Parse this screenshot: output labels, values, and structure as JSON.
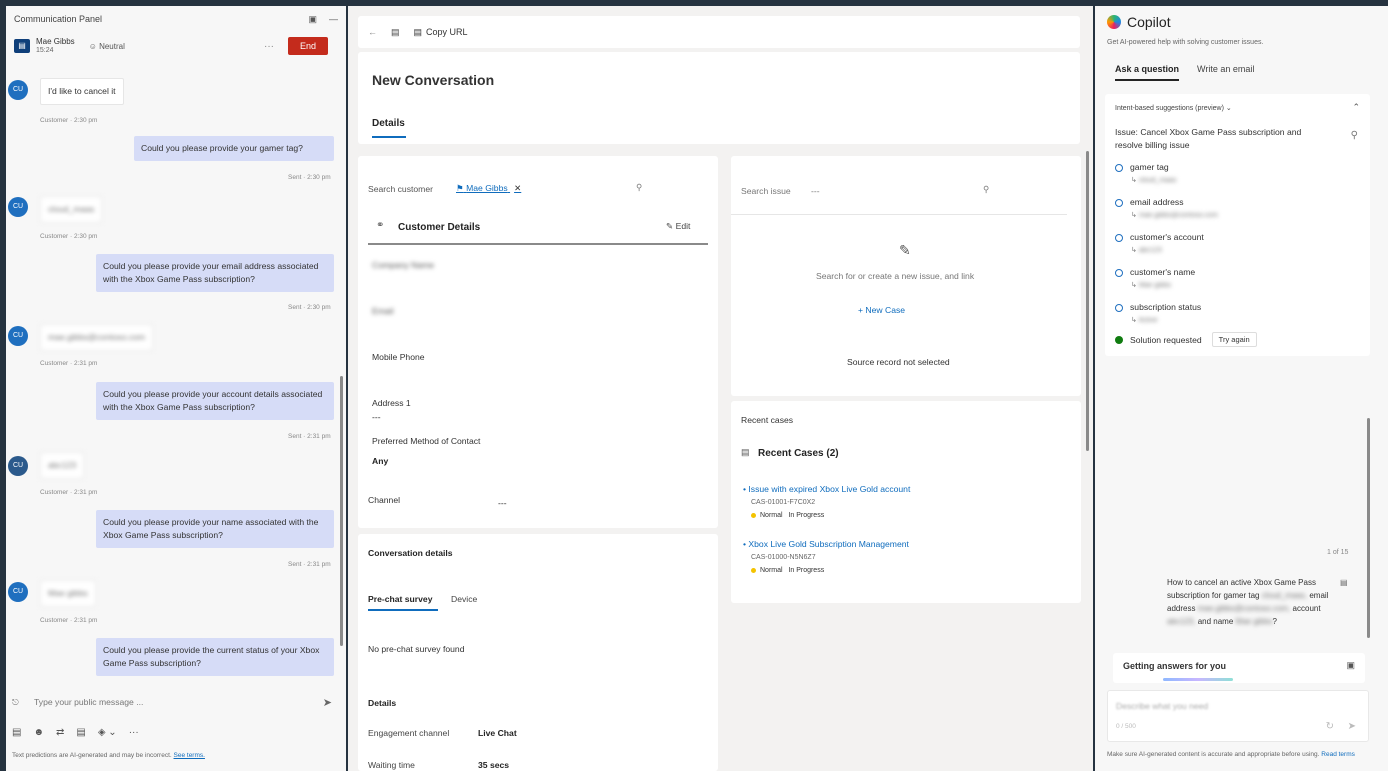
{
  "comm": {
    "title": "Communication Panel",
    "customer_name": "Mae Gibbs",
    "customer_time": "15:24",
    "sentiment": "Neutral",
    "end_label": "End",
    "messages": [
      {
        "text": "I'd like to cancel it",
        "meta": "Customer · 2:30 pm"
      },
      {
        "text": "Could you please provide your gamer tag?",
        "meta": "Sent · 2:30 pm"
      },
      {
        "text": "cloud_maas",
        "meta": "Customer · 2:30 pm"
      },
      {
        "text": "Could you please provide your email address associated with the Xbox Game Pass subscription?",
        "meta": "Sent · 2:30 pm"
      },
      {
        "text": "mae.gibbs@contoso.com",
        "meta": "Customer · 2:31 pm"
      },
      {
        "text": "Could you please provide your account details associated with the Xbox Game Pass subscription?",
        "meta": "Sent · 2:31 pm"
      },
      {
        "text": "abc123",
        "meta": "Customer · 2:31 pm"
      },
      {
        "text": "Could you please provide your name associated with the Xbox Game Pass subscription?",
        "meta": "Sent · 2:31 pm"
      },
      {
        "text": "Mae gibbs",
        "meta": "Customer · 2:31 pm"
      },
      {
        "text": "Could you please provide the current status of your Xbox Game Pass subscription?",
        "meta": ""
      }
    ],
    "compose_placeholder": "Type your public message ...",
    "disclaimer": "Text predictions are AI-generated and may be incorrect.",
    "see_terms": "See terms."
  },
  "main": {
    "copy_url": "Copy URL",
    "title": "New Conversation",
    "tab_details": "Details",
    "search_customer_label": "Search customer",
    "customer_link": "Mae Gibbs",
    "customer_details_title": "Customer Details",
    "edit_label": "Edit",
    "company_name": "Company Name",
    "email": "Email",
    "mobile_phone": "Mobile Phone",
    "address1": "Address 1",
    "address1_value": "---",
    "preferred_contact": "Preferred Method of Contact",
    "preferred_contact_value": "Any",
    "channel": "Channel",
    "channel_value": "---",
    "search_issue_label": "Search issue",
    "search_issue_value": "---",
    "issue_hint": "Search for or create a new issue, and link",
    "new_case": "+ New Case",
    "source_record": "Source record not selected",
    "recent_cases_label": "Recent cases",
    "recent_cases_title": "Recent Cases (2)",
    "cases": [
      {
        "title": "Issue with expired Xbox Live Gold account",
        "id": "CAS-01001-F7C0X2",
        "priority": "Normal",
        "status": "In Progress"
      },
      {
        "title": "Xbox Live Gold Subscription Management",
        "id": "CAS-01000-N5N6Z7",
        "priority": "Normal",
        "status": "In Progress"
      }
    ],
    "conv_details_title": "Conversation details",
    "tab_prechat": "Pre-chat survey",
    "tab_device": "Device",
    "no_prechat": "No pre-chat survey found",
    "details_title": "Details",
    "engagement_label": "Engagement channel",
    "engagement_value": "Live Chat",
    "waiting_label": "Waiting time",
    "waiting_value": "35 secs"
  },
  "copilot": {
    "title": "Copilot",
    "subtitle": "Get AI-powered help with solving customer issues.",
    "tab_ask": "Ask a question",
    "tab_email": "Write an email",
    "suggestions_header": "Intent-based suggestions (preview)",
    "issue_text": "Issue: Cancel Xbox Game Pass subscription and resolve billing issue",
    "items": [
      {
        "label": "gamer tag",
        "value": "cloud_maas"
      },
      {
        "label": "email address",
        "value": "mae.gibbs@contoso.com"
      },
      {
        "label": "customer's account",
        "value": "abc123"
      },
      {
        "label": "customer's name",
        "value": "Mae gibbs"
      },
      {
        "label": "subscription status",
        "value": "Active"
      }
    ],
    "solution_label": "Solution requested",
    "try_again": "Try again",
    "counter": "1 of 15",
    "user_question_a": "How to cancel an active Xbox Game Pass subscription for gamer tag",
    "user_question_b": "cloud_maas,",
    "user_question_c": "email address",
    "user_question_d": "mae.gibbs@contoso.com,",
    "user_question_e": "account",
    "user_question_f": "abc123,",
    "user_question_g": "and name",
    "user_question_h": "Mae gibbs",
    "user_question_i": "?",
    "getting_answers": "Getting answers for you",
    "ask_placeholder": "Describe what you need",
    "ask_count": "0 / 500",
    "disclaimer": "Make sure AI-generated content is accurate and appropriate before using.",
    "read_terms": "Read terms"
  },
  "colors": {
    "end_button": "#c42b1c",
    "agent_bubble": "#d6dcf7",
    "link": "#0f6cbd",
    "avatar": "#1f6fbf"
  }
}
